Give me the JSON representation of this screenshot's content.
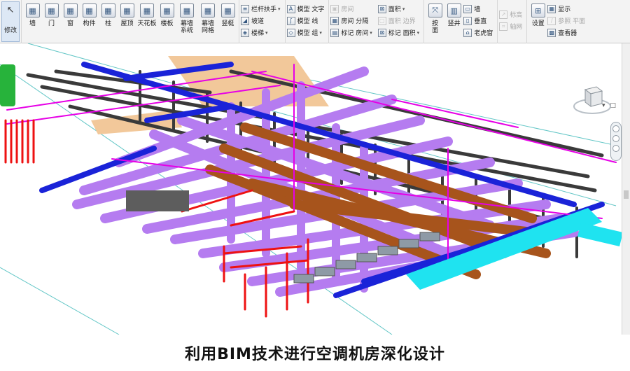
{
  "ribbon": {
    "modify_label": "修改",
    "build_buttons": [
      {
        "label": "墙",
        "icon": "wall-icon"
      },
      {
        "label": "门",
        "icon": "door-icon"
      },
      {
        "label": "窗",
        "icon": "window-icon"
      },
      {
        "label": "构件",
        "icon": "component-icon"
      },
      {
        "label": "柱",
        "icon": "column-icon"
      },
      {
        "label": "屋顶",
        "icon": "roof-icon"
      },
      {
        "label": "天花板",
        "icon": "ceiling-icon"
      },
      {
        "label": "楼板",
        "icon": "floor-icon"
      },
      {
        "label": "幕墙\n系统",
        "icon": "curtain-system-icon"
      },
      {
        "label": "幕墙\n网格",
        "icon": "curtain-grid-icon"
      },
      {
        "label": "竖梃",
        "icon": "mullion-icon"
      }
    ],
    "circulation": [
      "栏杆扶手",
      "坡道",
      "楼梯"
    ],
    "model": [
      "模型 文字",
      "模型 线",
      "模型 组"
    ],
    "room": [
      "房间",
      "房间 分隔",
      "标记 房间"
    ],
    "area": [
      "面积",
      "面积 边界",
      "标记 面积"
    ],
    "opening_big": [
      {
        "label": "按\n面"
      },
      {
        "label": "竖井"
      }
    ],
    "opening_small": [
      "墙",
      "垂直",
      "老虎窗"
    ],
    "datum": [
      "标高",
      "轴网"
    ],
    "workplane_big": "设置",
    "workplane_small": [
      "显示",
      "参照 平面",
      "查看器"
    ]
  },
  "caption": "利用BIM技术进行空调机房深化设计",
  "colors": {
    "purple_pipe": "#b57cf0",
    "blue_pipe": "#1a23d8",
    "brown_pipe": "#a7541c",
    "magenta_line": "#e600e6",
    "red_pipe": "#ee1111",
    "cyan_duct": "#1fe3f0",
    "dark_steel": "#3a3a3a",
    "tan_duct": "#f2c89a",
    "green_equipment": "#27b33b"
  }
}
